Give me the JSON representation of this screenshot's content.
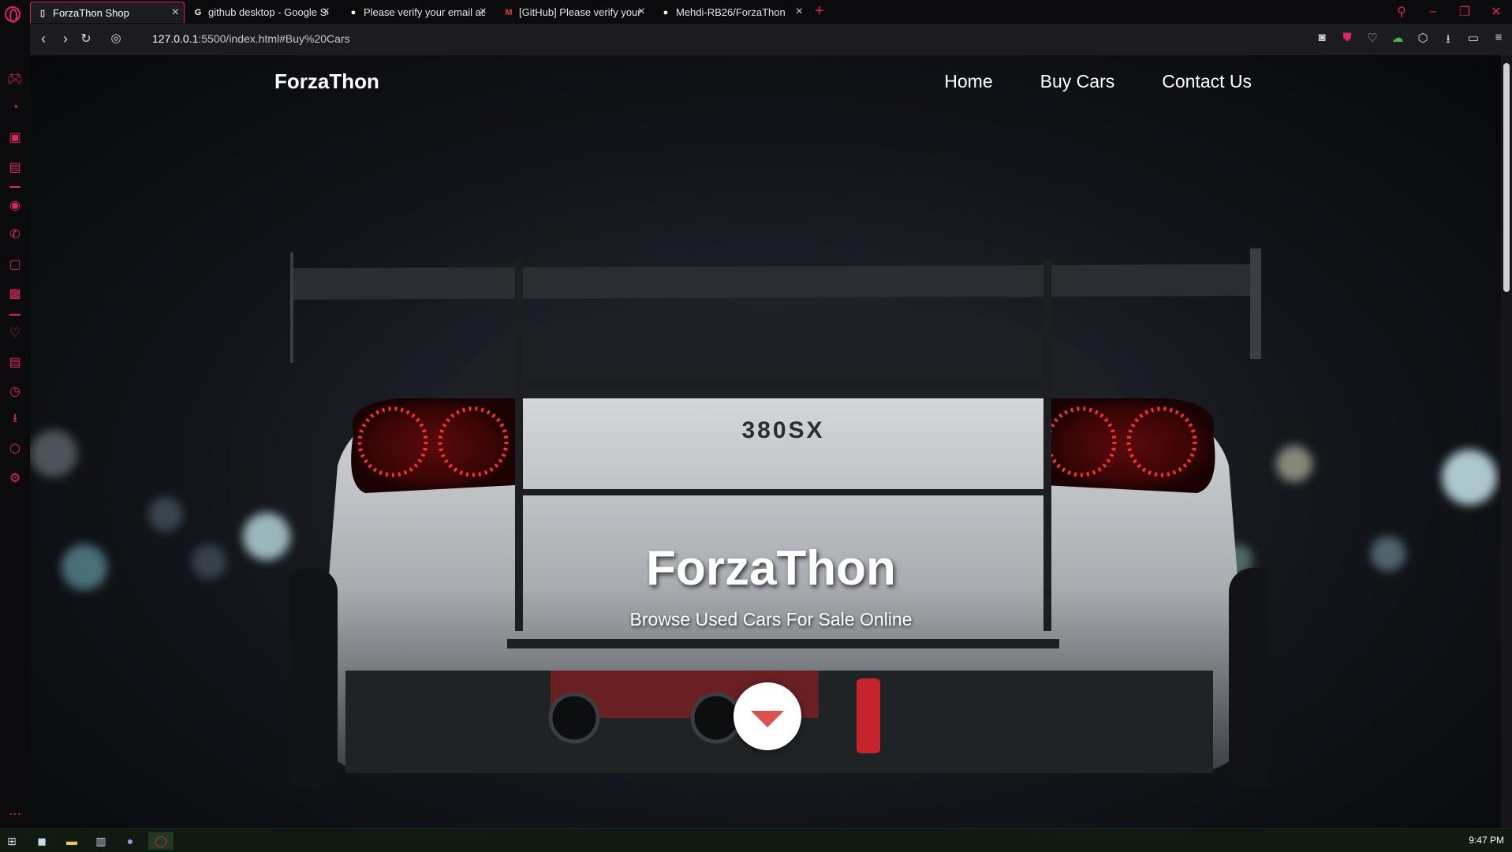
{
  "tabs": [
    {
      "title": "ForzaThon Shop",
      "favicon": "page-icon",
      "active": true
    },
    {
      "title": "github desktop - Google Se",
      "favicon": "google-icon",
      "active": false
    },
    {
      "title": "Please verify your email ad",
      "favicon": "github-icon",
      "active": false
    },
    {
      "title": "[GitHub] Please verify your",
      "favicon": "gmail-icon",
      "active": false
    },
    {
      "title": "Mehdi-RB26/ForzaThon",
      "favicon": "github-icon",
      "active": false
    }
  ],
  "address": {
    "host": "127.0.0.1",
    "path": ":5500/index.html#Buy%20Cars"
  },
  "page": {
    "logo": "ForzaThon",
    "nav": [
      "Home",
      "Buy Cars",
      "Contact Us"
    ],
    "hero_title": "ForzaThon",
    "hero_subtitle": "Browse Used Cars For Sale Online",
    "plate_text": "380SX"
  },
  "taskbar": {
    "clock": "9:47 PM"
  },
  "colors": {
    "accent": "#e0245e",
    "button": "#ffffff",
    "arrow": "#d9534f"
  }
}
